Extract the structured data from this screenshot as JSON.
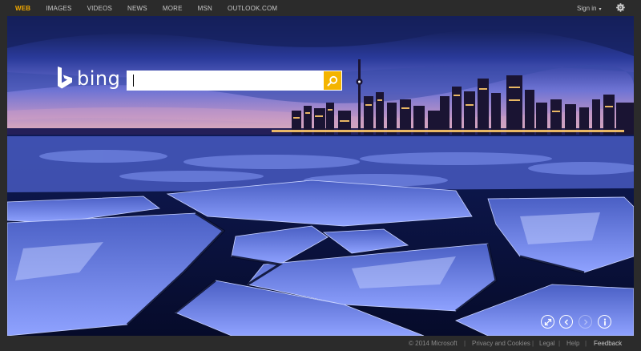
{
  "nav": {
    "items": [
      "WEB",
      "IMAGES",
      "VIDEOS",
      "NEWS",
      "MORE",
      "MSN",
      "OUTLOOK.COM"
    ],
    "active": "WEB"
  },
  "header": {
    "signin_label": "Sign in",
    "caret": "▾"
  },
  "logo": {
    "wordmark": "bing"
  },
  "search": {
    "value": "",
    "placeholder": ""
  },
  "footer": {
    "copyright": "© 2014 Microsoft",
    "privacy": "Privacy and Cookies",
    "legal": "Legal",
    "help": "Help",
    "feedback": "Feedback",
    "separator": "|"
  },
  "colors": {
    "accent": "#f2a900",
    "search_button": "#f4b400",
    "bar": "#2b2b2b"
  },
  "icons": {
    "settings": "gear-icon",
    "search": "magnifier-icon",
    "expand": "expand-icon",
    "previous": "chevron-left-icon",
    "next": "chevron-right-icon",
    "info": "info-icon"
  }
}
